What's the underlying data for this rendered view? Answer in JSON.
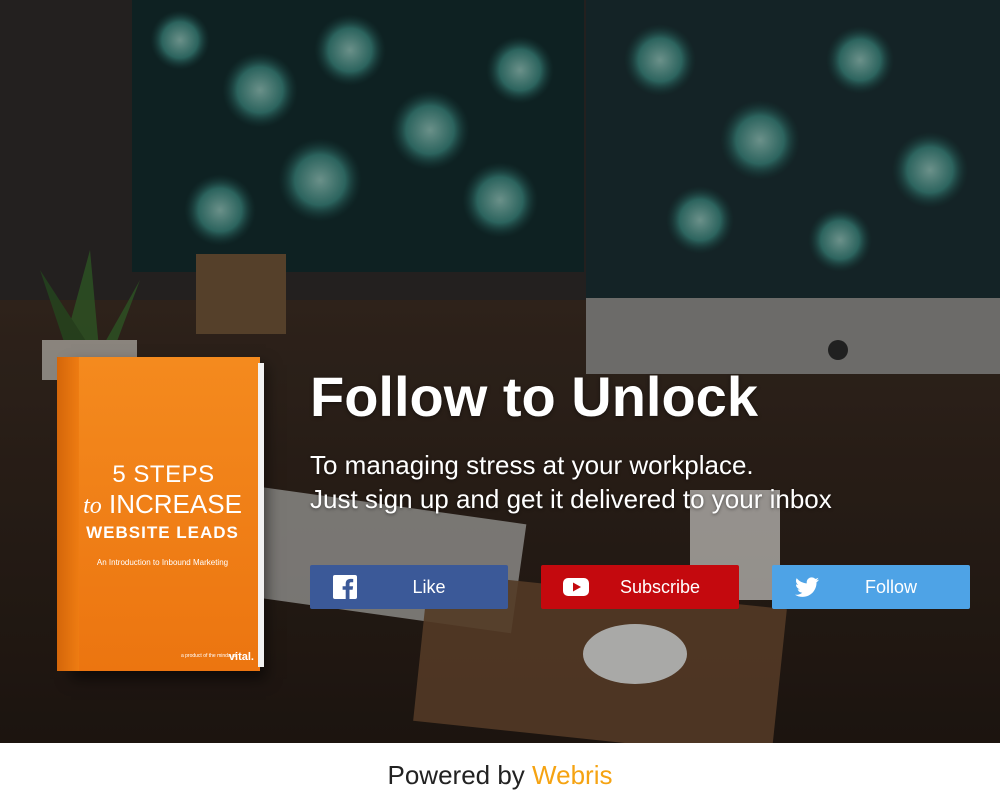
{
  "promo": {
    "headline": "Follow to Unlock",
    "subtitle_line1": "To managing stress at your workplace.",
    "subtitle_line2": "Just sign up and get it delivered to your inbox"
  },
  "book": {
    "line1": "5 STEPS",
    "line2_prefix": "to",
    "line2_word": "INCREASE",
    "line3": "WEBSITE LEADS",
    "subtitle": "An Introduction to Inbound Marketing",
    "publisher_note": "a product of the minds at",
    "publisher": "vital."
  },
  "buttons": {
    "like": {
      "label": "Like",
      "icon": "facebook-icon",
      "color": "#3b5998"
    },
    "subscribe": {
      "label": "Subscribe",
      "icon": "youtube-icon",
      "color": "#c4090e"
    },
    "follow": {
      "label": "Follow",
      "icon": "twitter-icon",
      "color": "#4ea3e6"
    }
  },
  "footer": {
    "prefix": "Powered by",
    "brand": "Webris",
    "brand_color": "#f5a312"
  }
}
